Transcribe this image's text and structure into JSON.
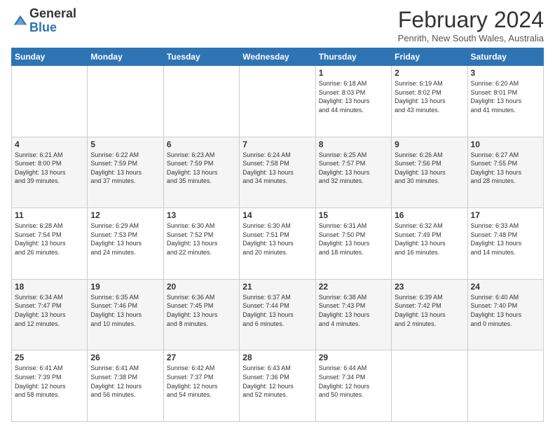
{
  "logo": {
    "general": "General",
    "blue": "Blue"
  },
  "header": {
    "title": "February 2024",
    "subtitle": "Penrith, New South Wales, Australia"
  },
  "weekdays": [
    "Sunday",
    "Monday",
    "Tuesday",
    "Wednesday",
    "Thursday",
    "Friday",
    "Saturday"
  ],
  "weeks": [
    [
      {
        "day": "",
        "info": ""
      },
      {
        "day": "",
        "info": ""
      },
      {
        "day": "",
        "info": ""
      },
      {
        "day": "",
        "info": ""
      },
      {
        "day": "1",
        "info": "Sunrise: 6:18 AM\nSunset: 8:03 PM\nDaylight: 13 hours\nand 44 minutes."
      },
      {
        "day": "2",
        "info": "Sunrise: 6:19 AM\nSunset: 8:02 PM\nDaylight: 13 hours\nand 43 minutes."
      },
      {
        "day": "3",
        "info": "Sunrise: 6:20 AM\nSunset: 8:01 PM\nDaylight: 13 hours\nand 41 minutes."
      }
    ],
    [
      {
        "day": "4",
        "info": "Sunrise: 6:21 AM\nSunset: 8:00 PM\nDaylight: 13 hours\nand 39 minutes."
      },
      {
        "day": "5",
        "info": "Sunrise: 6:22 AM\nSunset: 7:59 PM\nDaylight: 13 hours\nand 37 minutes."
      },
      {
        "day": "6",
        "info": "Sunrise: 6:23 AM\nSunset: 7:59 PM\nDaylight: 13 hours\nand 35 minutes."
      },
      {
        "day": "7",
        "info": "Sunrise: 6:24 AM\nSunset: 7:58 PM\nDaylight: 13 hours\nand 34 minutes."
      },
      {
        "day": "8",
        "info": "Sunrise: 6:25 AM\nSunset: 7:57 PM\nDaylight: 13 hours\nand 32 minutes."
      },
      {
        "day": "9",
        "info": "Sunrise: 6:26 AM\nSunset: 7:56 PM\nDaylight: 13 hours\nand 30 minutes."
      },
      {
        "day": "10",
        "info": "Sunrise: 6:27 AM\nSunset: 7:55 PM\nDaylight: 13 hours\nand 28 minutes."
      }
    ],
    [
      {
        "day": "11",
        "info": "Sunrise: 6:28 AM\nSunset: 7:54 PM\nDaylight: 13 hours\nand 26 minutes."
      },
      {
        "day": "12",
        "info": "Sunrise: 6:29 AM\nSunset: 7:53 PM\nDaylight: 13 hours\nand 24 minutes."
      },
      {
        "day": "13",
        "info": "Sunrise: 6:30 AM\nSunset: 7:52 PM\nDaylight: 13 hours\nand 22 minutes."
      },
      {
        "day": "14",
        "info": "Sunrise: 6:30 AM\nSunset: 7:51 PM\nDaylight: 13 hours\nand 20 minutes."
      },
      {
        "day": "15",
        "info": "Sunrise: 6:31 AM\nSunset: 7:50 PM\nDaylight: 13 hours\nand 18 minutes."
      },
      {
        "day": "16",
        "info": "Sunrise: 6:32 AM\nSunset: 7:49 PM\nDaylight: 13 hours\nand 16 minutes."
      },
      {
        "day": "17",
        "info": "Sunrise: 6:33 AM\nSunset: 7:48 PM\nDaylight: 13 hours\nand 14 minutes."
      }
    ],
    [
      {
        "day": "18",
        "info": "Sunrise: 6:34 AM\nSunset: 7:47 PM\nDaylight: 13 hours\nand 12 minutes."
      },
      {
        "day": "19",
        "info": "Sunrise: 6:35 AM\nSunset: 7:46 PM\nDaylight: 13 hours\nand 10 minutes."
      },
      {
        "day": "20",
        "info": "Sunrise: 6:36 AM\nSunset: 7:45 PM\nDaylight: 13 hours\nand 8 minutes."
      },
      {
        "day": "21",
        "info": "Sunrise: 6:37 AM\nSunset: 7:44 PM\nDaylight: 13 hours\nand 6 minutes."
      },
      {
        "day": "22",
        "info": "Sunrise: 6:38 AM\nSunset: 7:43 PM\nDaylight: 13 hours\nand 4 minutes."
      },
      {
        "day": "23",
        "info": "Sunrise: 6:39 AM\nSunset: 7:42 PM\nDaylight: 13 hours\nand 2 minutes."
      },
      {
        "day": "24",
        "info": "Sunrise: 6:40 AM\nSunset: 7:40 PM\nDaylight: 13 hours\nand 0 minutes."
      }
    ],
    [
      {
        "day": "25",
        "info": "Sunrise: 6:41 AM\nSunset: 7:39 PM\nDaylight: 12 hours\nand 58 minutes."
      },
      {
        "day": "26",
        "info": "Sunrise: 6:41 AM\nSunset: 7:38 PM\nDaylight: 12 hours\nand 56 minutes."
      },
      {
        "day": "27",
        "info": "Sunrise: 6:42 AM\nSunset: 7:37 PM\nDaylight: 12 hours\nand 54 minutes."
      },
      {
        "day": "28",
        "info": "Sunrise: 6:43 AM\nSunset: 7:36 PM\nDaylight: 12 hours\nand 52 minutes."
      },
      {
        "day": "29",
        "info": "Sunrise: 6:44 AM\nSunset: 7:34 PM\nDaylight: 12 hours\nand 50 minutes."
      },
      {
        "day": "",
        "info": ""
      },
      {
        "day": "",
        "info": ""
      }
    ]
  ]
}
